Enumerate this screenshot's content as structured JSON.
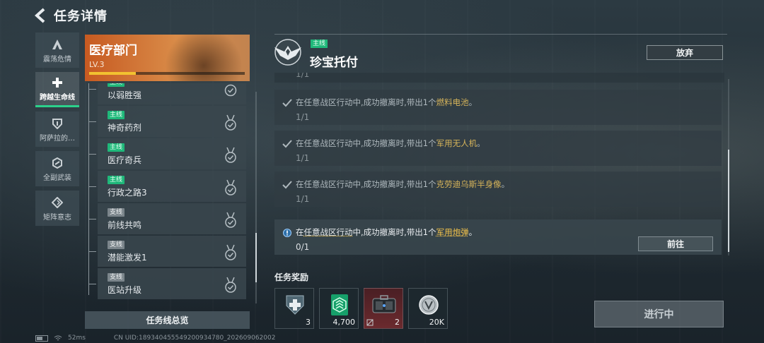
{
  "header": {
    "title": "任务详情"
  },
  "categories": [
    {
      "label": "震荡危情",
      "icon": "triangle-a-icon",
      "active": false
    },
    {
      "label": "跨越生命线",
      "icon": "plus-icon",
      "active": true
    },
    {
      "label": "阿萨拉的…",
      "icon": "shield-icon",
      "active": false
    },
    {
      "label": "全副武装",
      "icon": "hex-icon",
      "active": false
    },
    {
      "label": "矩阵意志",
      "icon": "diamond-arrows-icon",
      "active": false
    }
  ],
  "mission_line": {
    "name": "医疗部门",
    "level": "LV.3",
    "progress": 0.3
  },
  "missions": [
    {
      "tag": "主线",
      "type": "main",
      "name": "以弱胜强"
    },
    {
      "tag": "主线",
      "type": "main",
      "name": "神奇药剂"
    },
    {
      "tag": "主线",
      "type": "main",
      "name": "医疗奇兵"
    },
    {
      "tag": "主线",
      "type": "main",
      "name": "行政之路3"
    },
    {
      "tag": "支线",
      "type": "side",
      "name": "前线共鸣"
    },
    {
      "tag": "支线",
      "type": "side",
      "name": "潜能激发1"
    },
    {
      "tag": "支线",
      "type": "side",
      "name": "医站升级"
    }
  ],
  "overview_button": "任务线总览",
  "detail": {
    "tag": "主线",
    "title": "珍宝托付",
    "abandon_button": "放弃",
    "top_partial_progress": "1/1",
    "objectives": [
      {
        "prefix": "在",
        "zone": "任意战区行动",
        "middle": "中,成功撤离时,带出1个",
        "item": "燃料电池",
        "suffix": "。",
        "progress": "1/1",
        "done": true
      },
      {
        "prefix": "在",
        "zone": "任意战区行动",
        "middle": "中,成功撤离时,带出1个",
        "item": "军用无人机",
        "suffix": "。",
        "progress": "1/1",
        "done": true
      },
      {
        "prefix": "在",
        "zone": "任意战区行动",
        "middle": "中,成功撤离时,带出1个",
        "item": "克劳迪乌斯半身像",
        "suffix": "。",
        "progress": "1/1",
        "done": true
      },
      {
        "prefix": "在",
        "zone": "任意战区行动",
        "middle": "中,成功撤离时,带出1个",
        "item": "军用炮弹",
        "suffix": "。",
        "progress": "0/1",
        "done": false,
        "goto_button": "前往"
      }
    ],
    "rewards_title": "任务奖励",
    "rewards": [
      {
        "icon": "medic-shield-icon",
        "qty": "3"
      },
      {
        "icon": "reputation-badge-icon",
        "qty": "4,700"
      },
      {
        "icon": "equipment-case-icon",
        "qty": "2"
      },
      {
        "icon": "coin-icon",
        "qty": "20K"
      }
    ],
    "status_button": "进行中"
  },
  "footer": {
    "ping": "52ms",
    "uid": "CN UID:1893404555492009347​80_202609062002"
  },
  "colors": {
    "accent_green": "#1fb87a",
    "highlight_gold": "#f3c34b",
    "banner_orange": "#c75a21"
  }
}
